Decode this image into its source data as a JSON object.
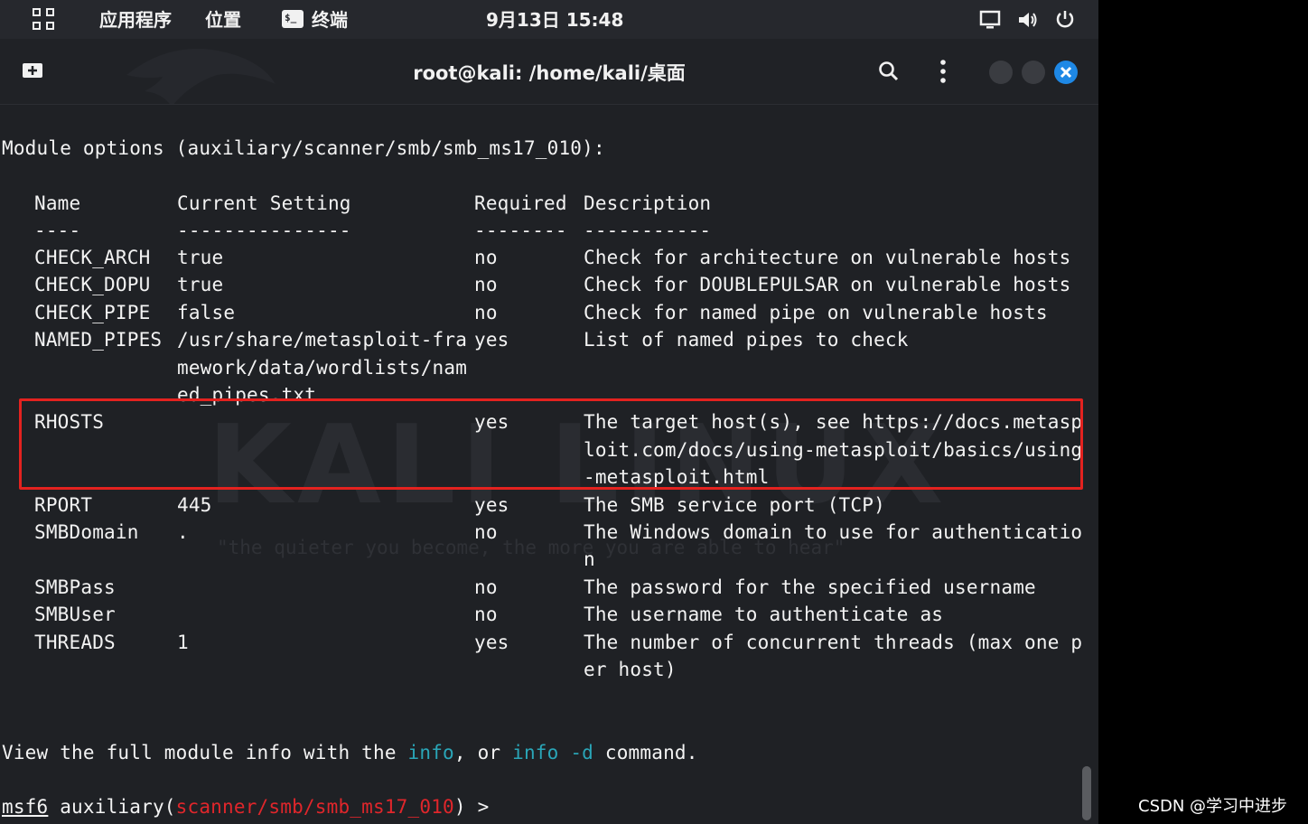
{
  "topbar": {
    "apps_label": "应用程序",
    "places_label": "位置",
    "terminal_label": "终端",
    "terminal_badge": "$_",
    "clock": "9月13日 15:48"
  },
  "window": {
    "title": "root@kali: /home/kali/桌面"
  },
  "terminal": {
    "header": "Module options (auxiliary/scanner/smb/smb_ms17_010):",
    "columns": [
      "Name",
      "Current Setting",
      "Required",
      "Description"
    ],
    "underlines": [
      "----",
      "---------------",
      "--------",
      "-----------"
    ],
    "rows": [
      {
        "name": "CHECK_ARCH",
        "current": [
          "true"
        ],
        "required": "no",
        "desc": [
          "Check for architecture on vulnerable hosts"
        ]
      },
      {
        "name": "CHECK_DOPU",
        "current": [
          "true"
        ],
        "required": "no",
        "desc": [
          "Check for DOUBLEPULSAR on vulnerable hosts"
        ]
      },
      {
        "name": "CHECK_PIPE",
        "current": [
          "false"
        ],
        "required": "no",
        "desc": [
          "Check for named pipe on vulnerable hosts"
        ]
      },
      {
        "name": "NAMED_PIPES",
        "current": [
          "/usr/share/metasploit-fra",
          "mework/data/wordlists/nam",
          "ed_pipes.txt"
        ],
        "required": "yes",
        "desc": [
          "List of named pipes to check"
        ]
      },
      {
        "name": "RHOSTS",
        "current": [],
        "required": "yes",
        "desc": [
          "The target host(s), see https://docs.metasp",
          "loit.com/docs/using-metasploit/basics/using",
          "-metasploit.html"
        ]
      },
      {
        "name": "RPORT",
        "current": [
          "445"
        ],
        "required": "yes",
        "desc": [
          "The SMB service port (TCP)"
        ]
      },
      {
        "name": "SMBDomain",
        "current": [
          "."
        ],
        "required": "no",
        "desc": [
          "The Windows domain to use for authenticatio",
          "n"
        ]
      },
      {
        "name": "SMBPass",
        "current": [],
        "required": "no",
        "desc": [
          "The password for the specified username"
        ]
      },
      {
        "name": "SMBUser",
        "current": [],
        "required": "no",
        "desc": [
          "The username to authenticate as"
        ]
      },
      {
        "name": "THREADS",
        "current": [
          "1"
        ],
        "required": "yes",
        "desc": [
          "The number of concurrent threads (max one p",
          "er host)"
        ]
      }
    ],
    "footer": {
      "before": "View the full module info with the ",
      "cmd1": "info",
      "middle": ", or ",
      "cmd2": "info -d",
      "after": " command."
    },
    "prompt": {
      "msf": "msf6",
      "module_prefix": " auxiliary(",
      "module": "scanner/smb/smb_ms17_010",
      "suffix": ") >"
    }
  },
  "watermark": {
    "logo": "KALI LINUX",
    "tagline": "\"the quieter you become, the more you are able to hear\""
  },
  "colors": {
    "highlight": "#e3221f",
    "close_button": "#1e88e5",
    "cyan": "#2aa6b8",
    "red": "#e0262b"
  },
  "credit": "CSDN @学习中进步"
}
